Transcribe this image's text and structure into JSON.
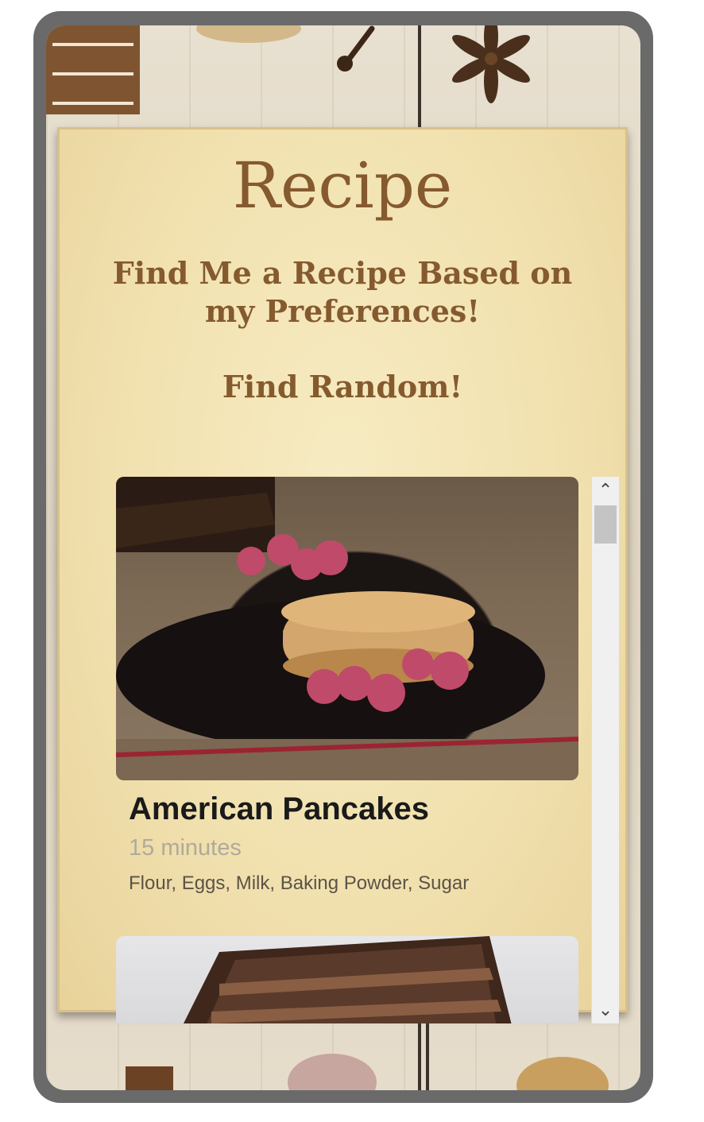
{
  "header": {
    "menu_icon": "hamburger-icon",
    "title": "Recipe",
    "find_preferences_label": "Find Me a Recipe Based on my Preferences!",
    "find_random_label": "Find Random!"
  },
  "recipes": [
    {
      "name": "American Pancakes",
      "time": "15 minutes",
      "ingredients": "Flour, Eggs, Milk, Baking Powder, Sugar",
      "image_subject": "pancakes with raspberries and syrup"
    },
    {
      "image_subject": "chocolate layer cake slice"
    }
  ],
  "scrollbar": {
    "up_icon": "chevron-up-icon",
    "down_icon": "chevron-down-icon"
  },
  "colors": {
    "accent": "#855a2f",
    "menu_bg": "#7f5531",
    "paper": "#f1e1af",
    "frame": "#6a6a6a"
  }
}
